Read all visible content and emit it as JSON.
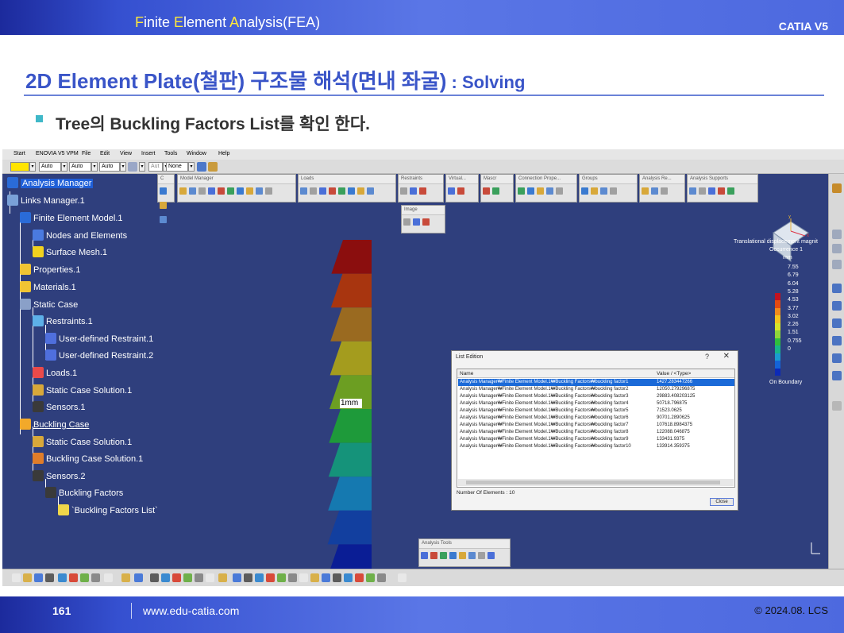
{
  "header": {
    "title_parts": [
      {
        "letter": "F",
        "rest": "inite "
      },
      {
        "letter": "E",
        "rest": "lement "
      },
      {
        "letter": "A",
        "rest": "nalysis(FEA)"
      }
    ],
    "app_name": "CATIA V5"
  },
  "slide": {
    "title": "2D Element Plate(철판) 구조물 해석(면내 좌굴)",
    "subtitle": " : Solving",
    "bullet": "Tree의 Buckling Factors List를 확인 한다."
  },
  "app": {
    "menu": [
      "Start",
      "ENOVIA V5 VPM",
      "File",
      "Edit",
      "View",
      "Insert",
      "Tools",
      "Window",
      "Help"
    ],
    "toolbar_fields": [
      "Auto",
      "Auto",
      "Auto",
      "Aut",
      "None"
    ],
    "floating_toolbars": [
      {
        "title": "C",
        "id": "c"
      },
      {
        "title": "Model Manager",
        "id": "model-manager"
      },
      {
        "title": "Loads",
        "id": "loads"
      },
      {
        "title": "Restraints",
        "id": "restraints"
      },
      {
        "title": "Virtual...",
        "id": "virtual"
      },
      {
        "title": "Mascr",
        "id": "mascr"
      },
      {
        "title": "Connection Prope...",
        "id": "connection"
      },
      {
        "title": "Groups",
        "id": "groups"
      },
      {
        "title": "Analysis Re...",
        "id": "analysis-results"
      },
      {
        "title": "Analysis Supports",
        "id": "analysis-supports"
      },
      {
        "title": "Image",
        "id": "image"
      },
      {
        "title": "Analysis Tools",
        "id": "analysis-tools"
      }
    ],
    "tree": [
      {
        "label": "Analysis Manager",
        "icon": "analysis-manager-icon",
        "selected": true
      },
      {
        "label": "Links Manager.1",
        "icon": "links-manager-icon"
      },
      {
        "label": "Finite Element Model.1",
        "icon": "fem-icon"
      },
      {
        "label": "Nodes and Elements",
        "icon": "nodes-icon"
      },
      {
        "label": "Surface Mesh.1",
        "icon": "mesh-icon"
      },
      {
        "label": "Properties.1",
        "icon": "folder-icon"
      },
      {
        "label": "Materials.1",
        "icon": "folder-icon"
      },
      {
        "label": "Static Case",
        "icon": "static-case-icon"
      },
      {
        "label": "Restraints.1",
        "icon": "restraints-icon"
      },
      {
        "label": "User-defined Restraint.1",
        "icon": "restraint-icon"
      },
      {
        "label": "User-defined Restraint.2",
        "icon": "restraint-icon"
      },
      {
        "label": "Loads.1",
        "icon": "loads-icon"
      },
      {
        "label": "Static Case Solution.1",
        "icon": "solution-icon"
      },
      {
        "label": "Sensors.1",
        "icon": "sensors-icon"
      },
      {
        "label": "Buckling Case",
        "icon": "buckling-case-icon",
        "underlined": true
      },
      {
        "label": "Static Case Solution.1",
        "icon": "solution-icon"
      },
      {
        "label": "Buckling Case Solution.1",
        "icon": "buckling-solution-icon"
      },
      {
        "label": "Sensors.2",
        "icon": "sensors-icon"
      },
      {
        "label": "Buckling Factors",
        "icon": "buckling-factors-icon"
      },
      {
        "label": "`Buckling Factors List`",
        "icon": "list-icon"
      }
    ],
    "mesh_label": "1mm",
    "legend": {
      "title": "Translational displacement magnit",
      "occurrence": "Occurrence 1",
      "unit": "mm",
      "values": [
        "7.55",
        "6.79",
        "6.04",
        "5.28",
        "4.53",
        "3.77",
        "3.02",
        "2.26",
        "1.51",
        "0.755",
        "0"
      ],
      "colors": [
        "#c1121f",
        "#e34a12",
        "#f08b1c",
        "#f3c41e",
        "#d7e32a",
        "#8ed43a",
        "#2fbe3c",
        "#18b58a",
        "#1a9bd1",
        "#1463d8",
        "#0c2ab7"
      ],
      "footer": "On Boundary"
    },
    "plate_colors": [
      "#8b0e0e",
      "#a8350f",
      "#9a6a20",
      "#a49c1e",
      "#6c9e22",
      "#1e9a3a",
      "#15937a",
      "#1579b0",
      "#123f9f",
      "#0a1d95"
    ]
  },
  "dialog": {
    "title": "List Edition",
    "help": "?",
    "close_glyph": "✕",
    "columns": [
      "Name",
      "Value / <Type>"
    ],
    "rows": [
      {
        "name": "Analysis Manager₩Finite Element Model.1₩Buckling Factors₩buckling factor1",
        "value": "1427.283447266"
      },
      {
        "name": "Analysis Manager₩Finite Element Model.1₩Buckling Factors₩buckling factor2",
        "value": "12050.279296875"
      },
      {
        "name": "Analysis Manager₩Finite Element Model.1₩Buckling Factors₩buckling factor3",
        "value": "29883.408203125"
      },
      {
        "name": "Analysis Manager₩Finite Element Model.1₩Buckling Factors₩buckling factor4",
        "value": "50718.796875"
      },
      {
        "name": "Analysis Manager₩Finite Element Model.1₩Buckling Factors₩buckling factor5",
        "value": "71523.0625"
      },
      {
        "name": "Analysis Manager₩Finite Element Model.1₩Buckling Factors₩buckling factor6",
        "value": "90701.2890625"
      },
      {
        "name": "Analysis Manager₩Finite Element Model.1₩Buckling Factors₩buckling factor7",
        "value": "107618.8984375"
      },
      {
        "name": "Analysis Manager₩Finite Element Model.1₩Buckling Factors₩buckling factor8",
        "value": "122088.046875"
      },
      {
        "name": "Analysis Manager₩Finite Element Model.1₩Buckling Factors₩buckling factor9",
        "value": "133431.9375"
      },
      {
        "name": "Analysis Manager₩Finite Element Model.1₩Buckling Factors₩buckling factor10",
        "value": "133914.359375"
      }
    ],
    "footer": "Number Of Elements : 10",
    "close_label": "Close"
  },
  "footer": {
    "page": "161",
    "url": "www.edu-catia.com",
    "copyright": "© 2024.08. LCS"
  },
  "colors": {
    "accent": "#3a55c8",
    "header_bg": "#4d69df",
    "viewport_bg": "#2f3f7d"
  }
}
